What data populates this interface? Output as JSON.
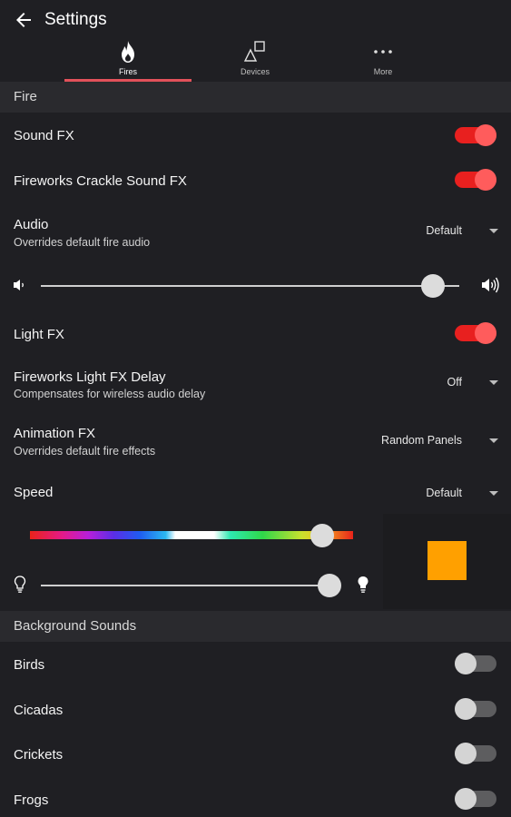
{
  "appbar": {
    "title": "Settings",
    "back_icon": "arrow-left-icon"
  },
  "tabs": [
    {
      "label": "Fires",
      "icon": "flame-icon",
      "active": true
    },
    {
      "label": "Devices",
      "icon": "shapes-icon",
      "active": false
    },
    {
      "label": "More",
      "icon": "more-dots-icon",
      "active": false
    }
  ],
  "fire_section": {
    "title": "Fire"
  },
  "sound_fx": {
    "label": "Sound FX",
    "on": true
  },
  "crackle_fx": {
    "label": "Fireworks Crackle Sound FX",
    "on": true
  },
  "audio": {
    "label": "Audio",
    "sublabel": "Overrides default fire audio",
    "value": "Default"
  },
  "volume": {
    "value": 0.94,
    "low_icon": "volume-low-icon",
    "high_icon": "volume-high-icon"
  },
  "light_fx": {
    "label": "Light FX",
    "on": true
  },
  "light_delay": {
    "label": "Fireworks Light FX Delay",
    "sublabel": "Compensates for wireless audio delay",
    "value": "Off"
  },
  "animation_fx": {
    "label": "Animation FX",
    "sublabel": "Overrides default fire effects",
    "value": "Random Panels"
  },
  "speed": {
    "label": "Speed",
    "value": "Default"
  },
  "color": {
    "hue_position": 0.905,
    "brightness": 0.94,
    "swatch": "#ffa000",
    "dim_icon": "bulb-outline-icon",
    "bright_icon": "bulb-filled-icon"
  },
  "background_section": {
    "title": "Background Sounds"
  },
  "background_sounds": [
    {
      "label": "Birds",
      "on": false
    },
    {
      "label": "Cicadas",
      "on": false
    },
    {
      "label": "Crickets",
      "on": false
    },
    {
      "label": "Frogs",
      "on": false
    }
  ],
  "colors": {
    "accent": "#e8201f",
    "tab_underline": "#e2515a",
    "background": "#1f1f23",
    "section": "#2a2a2e"
  }
}
